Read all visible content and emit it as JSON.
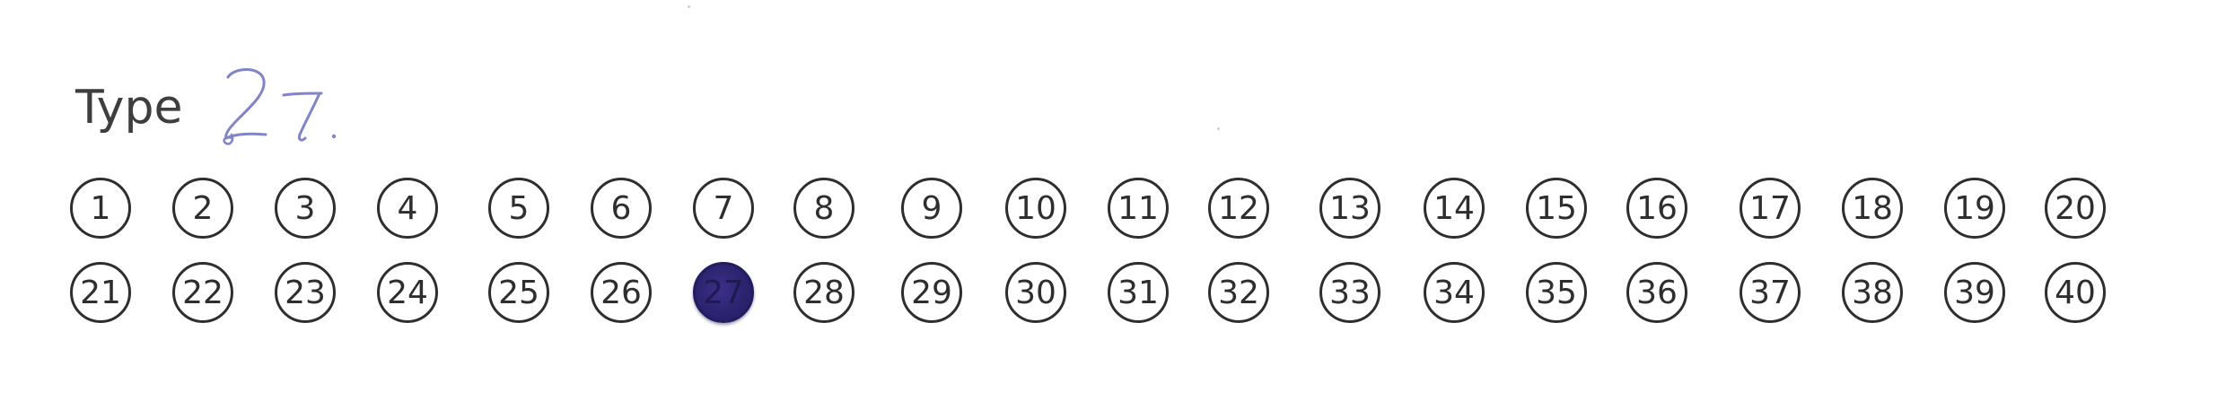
{
  "form": {
    "type_label": "Type",
    "handwritten_answer": "27",
    "ink_color": "#7f85c8",
    "fill_color": "#2c2470",
    "selected_value": "27",
    "options": [
      "1",
      "2",
      "3",
      "4",
      "5",
      "6",
      "7",
      "8",
      "9",
      "10",
      "11",
      "12",
      "13",
      "14",
      "15",
      "16",
      "17",
      "18",
      "19",
      "20",
      "21",
      "22",
      "23",
      "24",
      "25",
      "26",
      "27",
      "28",
      "29",
      "30",
      "31",
      "32",
      "33",
      "34",
      "35",
      "36",
      "37",
      "38",
      "39",
      "40"
    ]
  }
}
